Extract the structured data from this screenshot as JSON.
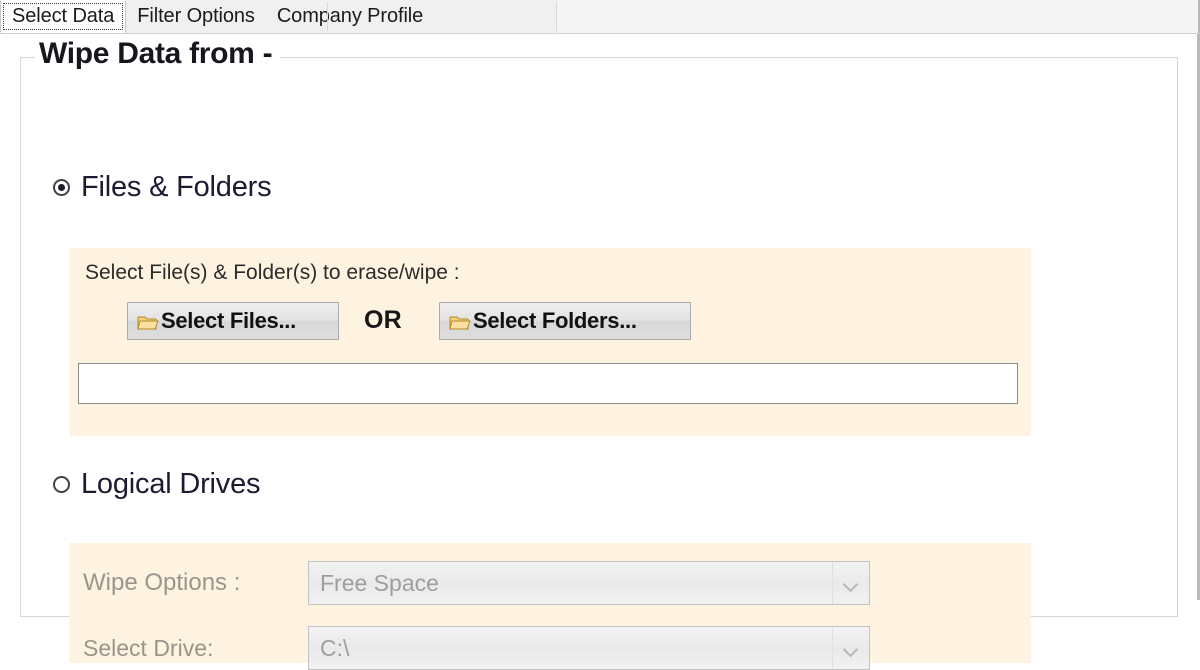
{
  "tabs": [
    {
      "label": "Select Data",
      "active": true
    },
    {
      "label": "Filter Options",
      "active": false
    },
    {
      "label": "Company Profile",
      "active": false
    }
  ],
  "groupbox": {
    "legend": "Wipe Data from -"
  },
  "files_section": {
    "radio_label": "Files & Folders",
    "selected": "selected",
    "caption": "Select File(s) & Folder(s) to erase/wipe :",
    "select_files_button": "Select Files...",
    "or_label": "OR",
    "select_folders_button": "Select Folders...",
    "path_textbox_value": "",
    "path_textbox_placeholder": "",
    "folder_icon": "folder-icon"
  },
  "drives_section": {
    "radio_label": "Logical Drives",
    "selected": "unselected",
    "wipe_options_label": "Wipe Options :",
    "wipe_options_value": "Free Space",
    "select_drive_label": "Select Drive:",
    "select_drive_value": "C:\\",
    "dropdown_icon": "chevron-down-icon"
  },
  "colors": {
    "panel_background": "#fdf3e0",
    "radio_text": "#1b1b32",
    "disabled_label": "#9a948c",
    "folder_icon": "#f2c14a"
  }
}
